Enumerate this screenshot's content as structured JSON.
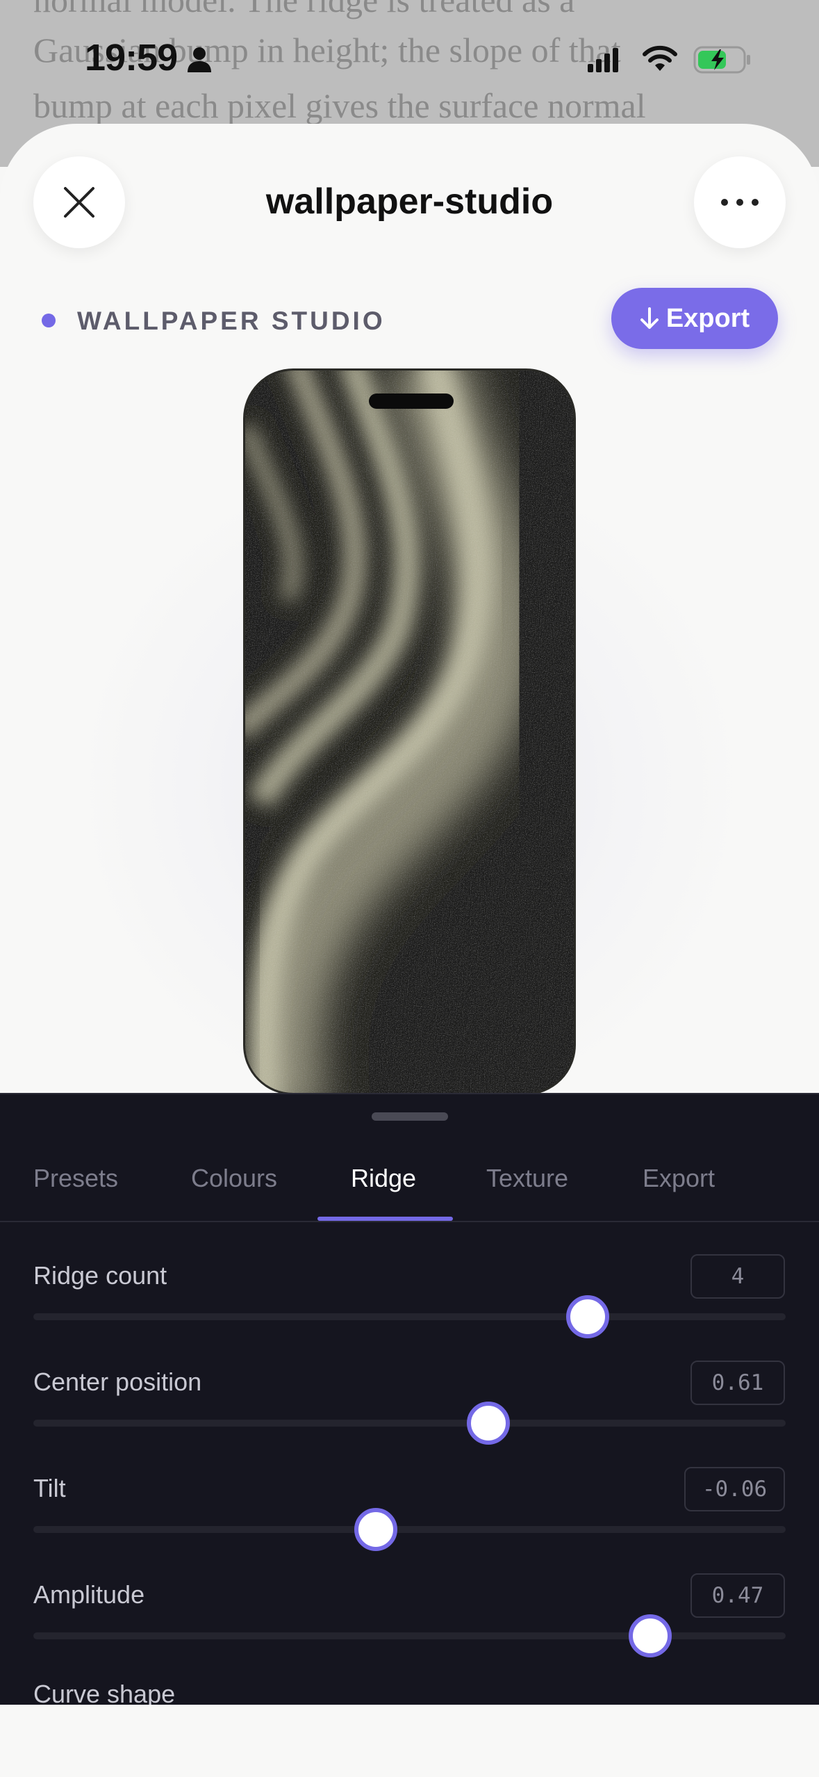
{
  "background_article": {
    "lines": [
      "normal model. The ridge is treated as a",
      "Gaussian bump in height; the slope of that",
      "bump at each pixel gives the surface normal"
    ]
  },
  "status_bar": {
    "time": "19:59"
  },
  "sheet": {
    "title": "wallpaper-studio",
    "close_icon": "close-icon",
    "more_icon": "more-icon"
  },
  "header": {
    "brand_label": "WALLPAPER STUDIO",
    "export_button_label": "Export",
    "accent_color": "#7469e6"
  },
  "preview": {
    "colors": [
      "#1f1f1a",
      "#b9b7a0"
    ]
  },
  "tabs": [
    {
      "label": "Presets",
      "active": false
    },
    {
      "label": "Colours",
      "active": false
    },
    {
      "label": "Ridge",
      "active": true
    },
    {
      "label": "Texture",
      "active": false
    },
    {
      "label": "Export",
      "active": false
    }
  ],
  "controls": [
    {
      "label": "Ridge count",
      "value": "4",
      "level": 0.737
    },
    {
      "label": "Center position",
      "value": "0.61",
      "level": 0.605
    },
    {
      "label": "Tilt",
      "value": "-0.06",
      "level": 0.455
    },
    {
      "label": "Amplitude",
      "value": "0.47",
      "level": 0.82
    },
    {
      "label": "Curve shape"
    }
  ]
}
